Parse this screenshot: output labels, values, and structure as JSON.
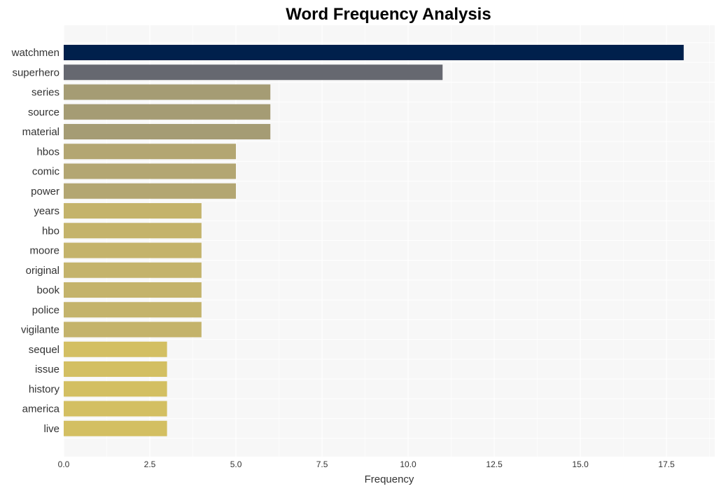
{
  "chart_data": {
    "type": "bar",
    "orientation": "horizontal",
    "title": "Word Frequency Analysis",
    "xlabel": "Frequency",
    "ylabel": "",
    "xlim": [
      0,
      18.9
    ],
    "xticks": [
      0.0,
      2.5,
      5.0,
      7.5,
      10.0,
      12.5,
      15.0,
      17.5
    ],
    "xtick_labels": [
      "0.0",
      "2.5",
      "5.0",
      "7.5",
      "10.0",
      "12.5",
      "15.0",
      "17.5"
    ],
    "grid": true,
    "legend": "none",
    "background": "#f7f7f7",
    "categories": [
      "watchmen",
      "superhero",
      "series",
      "source",
      "material",
      "hbos",
      "comic",
      "power",
      "years",
      "hbo",
      "moore",
      "original",
      "book",
      "police",
      "vigilante",
      "sequel",
      "issue",
      "history",
      "america",
      "live"
    ],
    "values": [
      18,
      11,
      6,
      6,
      6,
      5,
      5,
      5,
      4,
      4,
      4,
      4,
      4,
      4,
      4,
      3,
      3,
      3,
      3,
      3
    ],
    "colors": [
      "#00204c",
      "#666870",
      "#a59c74",
      "#a59c74",
      "#a59c74",
      "#b3a672",
      "#b3a672",
      "#b3a672",
      "#c4b36b",
      "#c4b36b",
      "#c4b36b",
      "#c4b36b",
      "#c4b36b",
      "#c4b36b",
      "#c4b36b",
      "#d3bf62",
      "#d3bf62",
      "#d3bf62",
      "#d3bf62",
      "#d3bf62"
    ]
  }
}
